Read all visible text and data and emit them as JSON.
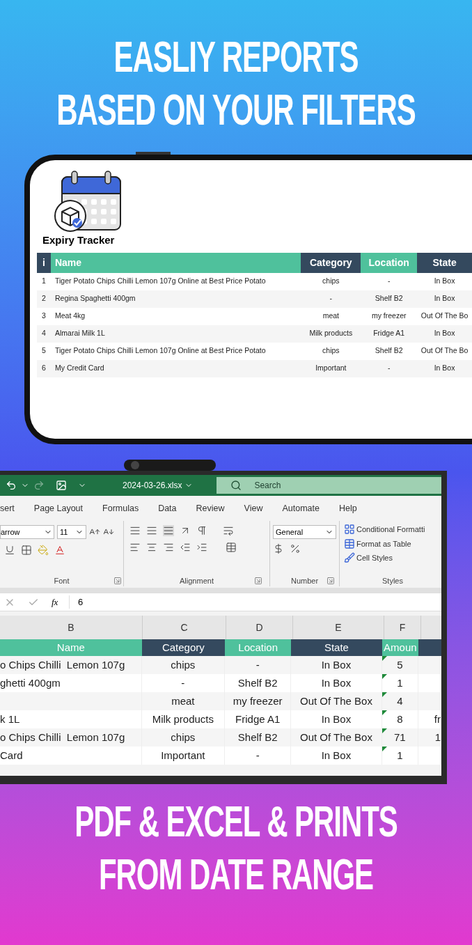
{
  "headline_top": [
    "EASLIY REPORTS",
    "BASED ON YOUR FILTERS"
  ],
  "phone": {
    "app_title": "Expiry Tracker",
    "columns": [
      {
        "label": "i",
        "color": "#34495e"
      },
      {
        "label": "Name",
        "color": "#4fc19c"
      },
      {
        "label": "Category",
        "color": "#34495e"
      },
      {
        "label": "Location",
        "color": "#4fc19c"
      },
      {
        "label": "State",
        "color": "#34495e"
      }
    ],
    "rows": [
      {
        "cells": [
          "1",
          "Tiger Potato Chips Chilli Lemon 107g Online at Best Price Potato",
          "chips",
          "-",
          "In Box"
        ]
      },
      {
        "cells": [
          "2",
          "Regina Spaghetti 400gm",
          "-",
          "Shelf B2",
          "In Box"
        ]
      },
      {
        "cells": [
          "3",
          "Meat 4kg",
          "meat",
          "my freezer",
          "Out Of The Bo"
        ]
      },
      {
        "cells": [
          "4",
          "Almarai Milk 1L",
          "Milk products",
          "Fridge A1",
          "In Box"
        ]
      },
      {
        "cells": [
          "5",
          "Tiger Potato Chips Chilli Lemon 107g Online at Best Price Potato",
          "chips",
          "Shelf B2",
          "Out Of The Bo"
        ]
      },
      {
        "cells": [
          "6",
          "My Credit Card",
          "Important",
          "-",
          "In Box"
        ]
      }
    ]
  },
  "excel": {
    "file_name": "2024-03-26.xlsx",
    "search_placeholder": "Search",
    "menu": [
      "sert",
      "Page Layout",
      "Formulas",
      "Data",
      "Review",
      "View",
      "Automate",
      "Help"
    ],
    "font_name": "arrow",
    "font_size": "11",
    "number_format": "General",
    "styles": [
      "Conditional Formatti",
      "Format as Table",
      "Cell Styles"
    ],
    "groups": [
      "Font",
      "Alignment",
      "Number",
      "Styles"
    ],
    "formula_label": "fx",
    "formula_value": "6",
    "column_letters": [
      "B",
      "C",
      "D",
      "E",
      "F"
    ],
    "header": [
      {
        "label": "Name",
        "color": "#4fc19c"
      },
      {
        "label": "Category",
        "color": "#34495e"
      },
      {
        "label": "Location",
        "color": "#4fc19c"
      },
      {
        "label": "State",
        "color": "#34495e"
      },
      {
        "label": "Amoun",
        "color": "#4fc19c"
      },
      {
        "color": "#34495e"
      }
    ],
    "rows": [
      {
        "cells": [
          "o Chips Chilli  Lemon 107g",
          "chips",
          "-",
          "In Box",
          "5"
        ]
      },
      {
        "cells": [
          "ghetti 400gm",
          "-",
          "Shelf B2",
          "In Box",
          "1"
        ]
      },
      {
        "cells": [
          null,
          "meat",
          "my freezer",
          "Out Of The Box",
          "4"
        ]
      },
      {
        "cells": [
          "k 1L",
          "Milk products",
          "Fridge A1",
          "In Box",
          "8",
          "fr"
        ]
      },
      {
        "cells": [
          "o Chips Chilli  Lemon 107g",
          "chips",
          "Shelf B2",
          "Out Of The Box",
          "71",
          "1"
        ]
      },
      {
        "cells": [
          "Card",
          "Important",
          "-",
          "In Box",
          "1"
        ]
      }
    ]
  },
  "headline_bottom": [
    "PDF & EXCEL & PRINTS",
    "FROM DATE RANGE"
  ]
}
